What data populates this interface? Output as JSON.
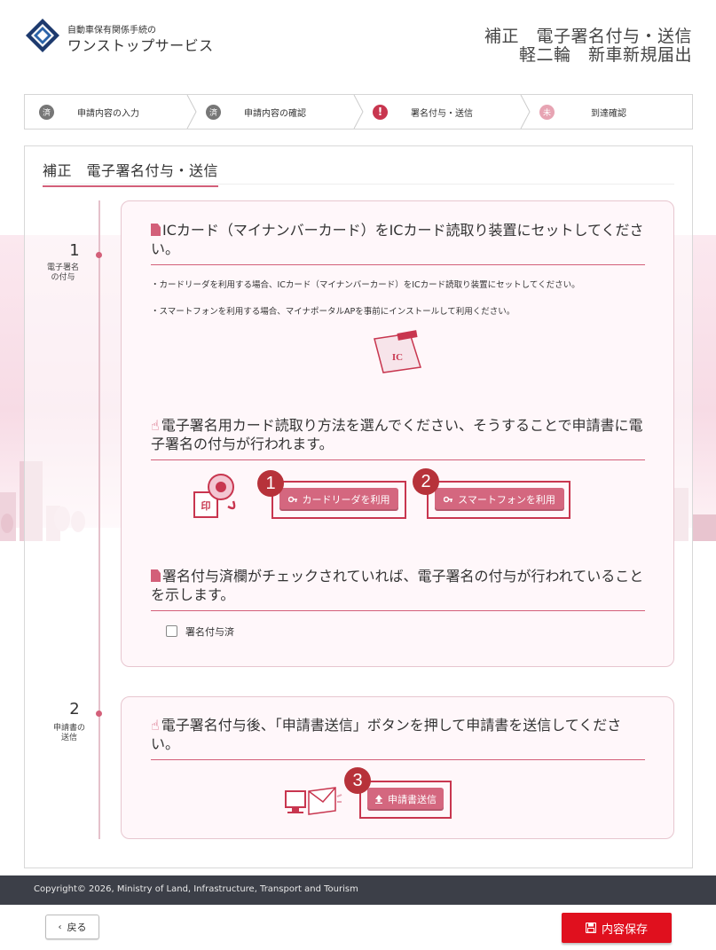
{
  "colors": {
    "accent": "#d35f79",
    "marker": "#b7323a",
    "save_button": "#e0101e",
    "footer_bg": "#3c3f48"
  },
  "header": {
    "logo_small": "自動車保有関係手続の",
    "logo_big": "ワンストップサービス",
    "title_line1": "補正　電子署名付与・送信",
    "title_line2": "軽二輪　新車新規届出",
    "logo_icon": "diamond-logo-icon"
  },
  "steps": [
    {
      "badge": "済",
      "label": "申請内容の入力",
      "state": "done"
    },
    {
      "badge": "済",
      "label": "申請内容の確認",
      "state": "done"
    },
    {
      "badge": "!",
      "label": "署名付与・送信",
      "state": "current"
    },
    {
      "badge": "未",
      "label": "到達確認",
      "state": "todo"
    }
  ],
  "panel": {
    "title": "補正　電子署名付与・送信"
  },
  "timeline": [
    {
      "num": "1",
      "label1": "電子署名",
      "label2": "の付与"
    },
    {
      "num": "2",
      "label1": "申請書の",
      "label2": "送信"
    }
  ],
  "card1": {
    "heading1": "ICカード（マイナンバーカード）をICカード読取り装置にセットしてください。",
    "note1": "・カードリーダを利用する場合、ICカード（マイナンバーカード）をICカード読取り装置にセットしてください。",
    "note2": "・スマートフォンを利用する場合、マイナポータルAPを事前にインストールして利用ください。",
    "ic_label": "IC",
    "heading2": "電子署名用カード読取り方法を選んでください、そうすることで申請書に電子署名の付与が行われます。",
    "btn_cardreader": "カードリーダを利用",
    "btn_smartphone": "スマートフォンを利用",
    "stamp_label": "印",
    "heading3": "署名付与済欄がチェックされていれば、電子署名の付与が行われていることを示します。",
    "checkbox_label": "署名付与済",
    "checkbox_checked": false
  },
  "card2": {
    "heading": "電子署名付与後、「申請書送信」ボタンを押して申請書を送信してください。",
    "btn_send": "申請書送信"
  },
  "markers": [
    "1",
    "2",
    "3"
  ],
  "footer": {
    "copyright": "Copyright© 2026, Ministry of Land, Infrastructure, Transport and Tourism"
  },
  "actions": {
    "back": "戻る",
    "save": "内容保存"
  }
}
